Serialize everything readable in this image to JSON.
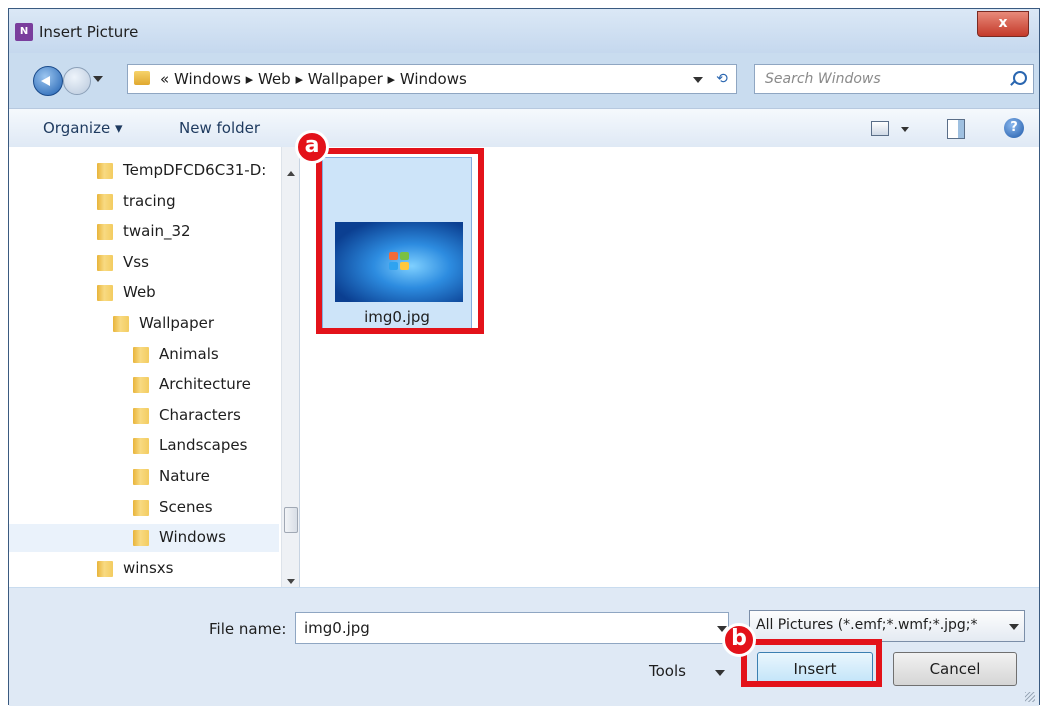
{
  "window": {
    "title": "Insert Picture",
    "app_icon": "N",
    "close_label": "x"
  },
  "address": {
    "crumbs": "« Windows ▸ Web ▸ Wallpaper ▸ Windows",
    "search_placeholder": "Search Windows"
  },
  "toolbar": {
    "organize_label": "Organize ▾",
    "new_folder_label": "New folder",
    "help_label": "?"
  },
  "tree": {
    "items": [
      {
        "label": "TempDFCD6C31-D:",
        "level": 1
      },
      {
        "label": "tracing",
        "level": 1
      },
      {
        "label": "twain_32",
        "level": 1
      },
      {
        "label": "Vss",
        "level": 1
      },
      {
        "label": "Web",
        "level": 1
      },
      {
        "label": "Wallpaper",
        "level": 2
      },
      {
        "label": "Animals",
        "level": 3
      },
      {
        "label": "Architecture",
        "level": 3
      },
      {
        "label": "Characters",
        "level": 3
      },
      {
        "label": "Landscapes",
        "level": 3
      },
      {
        "label": "Nature",
        "level": 3
      },
      {
        "label": "Scenes",
        "level": 3
      },
      {
        "label": "Windows",
        "level": 3,
        "selected": true
      },
      {
        "label": "winsxs",
        "level": 1
      }
    ]
  },
  "files": [
    {
      "name": "img0.jpg",
      "selected": true
    }
  ],
  "callouts": {
    "a": "a",
    "b": "b",
    "color": "#e3121a"
  },
  "bottom": {
    "filename_label": "File name:",
    "filename_value": "img0.jpg",
    "filetype_value": "All Pictures (*.emf;*.wmf;*.jpg;*",
    "tools_label": "Tools",
    "insert_label": "Insert",
    "cancel_label": "Cancel"
  }
}
